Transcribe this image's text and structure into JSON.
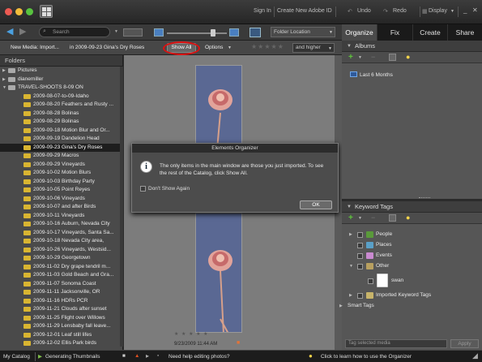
{
  "titlebar": {
    "sign_in": "Sign In",
    "create_id": "Create New Adobe ID",
    "undo": "Undo",
    "redo": "Redo",
    "display": "Display"
  },
  "toolbar": {
    "search_placeholder": "Search",
    "folder_location": "Folder Location"
  },
  "tabs": [
    {
      "label": "Organize"
    },
    {
      "label": "Fix"
    },
    {
      "label": "Create"
    },
    {
      "label": "Share"
    }
  ],
  "mediabar": {
    "new_media_text": "New Media: Import...",
    "folder_text": "in 2009-09-23 Gina's Dry Roses",
    "show_all": "Show All",
    "options": "Options",
    "rating_filter": "and higher"
  },
  "folders": {
    "title": "Folders",
    "items": [
      {
        "label": "Pictures",
        "level": 0,
        "color": "gray"
      },
      {
        "label": "dianemiller",
        "level": 0,
        "color": "gray"
      },
      {
        "label": "TRAVEL-SHOOTS 8-09 ON",
        "level": 0,
        "color": "gray"
      },
      {
        "label": "2009-08-07-to-09-Idaho",
        "level": 1
      },
      {
        "label": "2009-08-20 Feathers and Rusty ...",
        "level": 1
      },
      {
        "label": "2009-08-28 Bolinas",
        "level": 1
      },
      {
        "label": "2009-08-29 Bolinas",
        "level": 1
      },
      {
        "label": "2009-09-18 Motion Blur and Or...",
        "level": 1
      },
      {
        "label": "2009-09-19 Dandelion Head",
        "level": 1
      },
      {
        "label": "2009-09-23 Gina's Dry Roses",
        "level": 1,
        "selected": true
      },
      {
        "label": "2009-09-29 Macros",
        "level": 1
      },
      {
        "label": "2009-09-29 Vineyards",
        "level": 1
      },
      {
        "label": "2009-10-02 Motion Blurs",
        "level": 1
      },
      {
        "label": "2009-10-03 Birthday Party",
        "level": 1
      },
      {
        "label": "2009-10-05 Point Reyes",
        "level": 1
      },
      {
        "label": "2009-10-06 Vineyards",
        "level": 1
      },
      {
        "label": "2009-10-07 and after Birds",
        "level": 1
      },
      {
        "label": "2009-10-11 Vineyards",
        "level": 1
      },
      {
        "label": "2009-10-16 Auburn, Nevada City",
        "level": 1
      },
      {
        "label": "2009-10-17 Vineyards, Santa Sa...",
        "level": 1
      },
      {
        "label": "2009-10-18 Nevada City area,",
        "level": 1
      },
      {
        "label": "2009-10-26 Vineyards, Westsid...",
        "level": 1
      },
      {
        "label": "2009-10-29 Georgetown",
        "level": 1
      },
      {
        "label": "2009-11-02 Dry grape tendril m...",
        "level": 1
      },
      {
        "label": "2009-11-03 Gold Beach and Gra...",
        "level": 1
      },
      {
        "label": "2009-11-07 Sonoma Coast",
        "level": 1
      },
      {
        "label": "2009-11-11 Jacksonville, OR",
        "level": 1
      },
      {
        "label": "2009-11-16 HDRs PCR",
        "level": 1
      },
      {
        "label": "2009-11-21 Clouds after sunset",
        "level": 1
      },
      {
        "label": "2009-11-25 Flight over Willows",
        "level": 1
      },
      {
        "label": "2009-11-29 Lensbaby fall leave...",
        "level": 1
      },
      {
        "label": "2009-12-01 Leaf still lifes",
        "level": 1
      },
      {
        "label": "2009-12-02 Ellis Park birds",
        "level": 1
      }
    ]
  },
  "grid": {
    "photo_date": "9/23/2009 11:44 AM",
    "rating_stars": "★ ★ ★ ★ ★"
  },
  "dialog": {
    "title": "Elements Organizer",
    "message": "The only items in the main window are those you just imported. To see the rest of the Catalog, click Show All.",
    "dont_show": "Don't Show Again",
    "ok": "OK"
  },
  "albums": {
    "title": "Albums",
    "items": [
      {
        "label": "Last 6 Months"
      }
    ]
  },
  "keyword_tags": {
    "title": "Keyword Tags",
    "items": [
      {
        "label": "People",
        "color": "#5a9a3a"
      },
      {
        "label": "Places",
        "color": "#5aa0c8"
      },
      {
        "label": "Events",
        "color": "#c98ad0"
      },
      {
        "label": "Other",
        "color": "#b8a060"
      },
      {
        "label": "swan",
        "color": "#ffffff"
      },
      {
        "label": "Imported Keyword Tags",
        "color": "#c8b46a"
      },
      {
        "label": "Smart Tags",
        "color": ""
      }
    ],
    "input_placeholder": "Tag selected media",
    "apply": "Apply"
  },
  "status": {
    "catalog": "My Catalog",
    "generating": "Generating Thumbnails",
    "help": "Need help editing photos?",
    "learn": "Click to learn how to use the Organizer"
  },
  "colors": {
    "highlight_circle": "#dd1111",
    "folder_icon": "#d9b531",
    "selected_row": "#1e1e1e"
  }
}
